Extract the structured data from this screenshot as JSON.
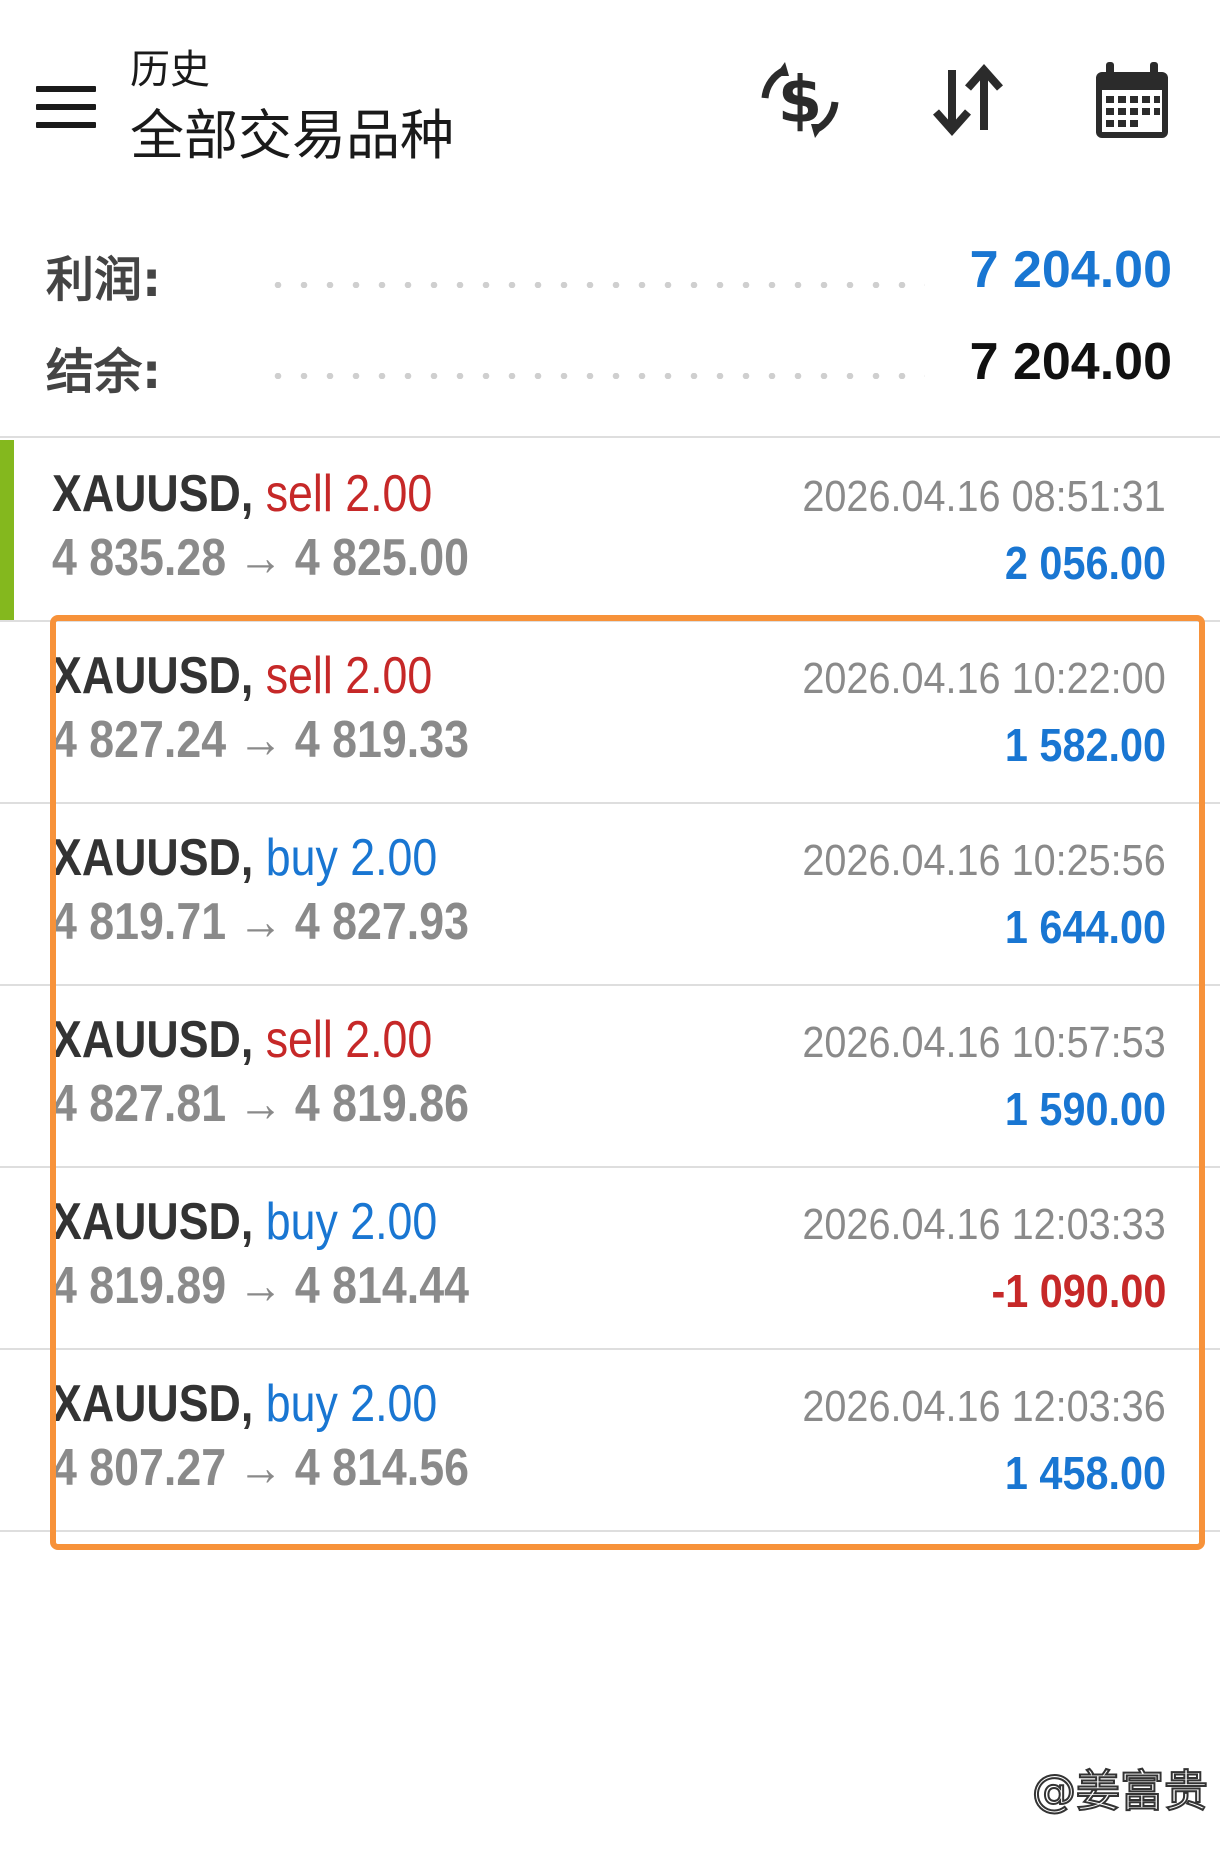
{
  "header": {
    "title_small": "历史",
    "title_big": "全部交易品种",
    "icons": [
      "menu-icon",
      "currency-exchange-icon",
      "sort-icon",
      "calendar-icon"
    ]
  },
  "summary": {
    "profit_label": "利润:",
    "profit_value": "7 204.00",
    "balance_label": "结余:",
    "balance_value": "7 204.00"
  },
  "colors": {
    "profit_positive": "#1976d2",
    "profit_negative": "#c62828",
    "sell": "#c62828",
    "buy": "#1976d2",
    "accent_bar": "#84b81e",
    "highlight_box": "#f7923a"
  },
  "trades": [
    {
      "symbol": "XAUUSD,",
      "type": "sell",
      "volume": "2.00",
      "open_price": "4 835.28",
      "arrow": "→",
      "close_price": "4 825.00",
      "time": "2026.04.16 08:51:31",
      "profit": "2 056.00",
      "profit_sign": "positive"
    },
    {
      "symbol": "XAUUSD,",
      "type": "sell",
      "volume": "2.00",
      "open_price": "4 827.24",
      "arrow": "→",
      "close_price": "4 819.33",
      "time": "2026.04.16 10:22:00",
      "profit": "1 582.00",
      "profit_sign": "positive"
    },
    {
      "symbol": "XAUUSD,",
      "type": "buy",
      "volume": "2.00",
      "open_price": "4 819.71",
      "arrow": "→",
      "close_price": "4 827.93",
      "time": "2026.04.16 10:25:56",
      "profit": "1 644.00",
      "profit_sign": "positive"
    },
    {
      "symbol": "XAUUSD,",
      "type": "sell",
      "volume": "2.00",
      "open_price": "4 827.81",
      "arrow": "→",
      "close_price": "4 819.86",
      "time": "2026.04.16 10:57:53",
      "profit": "1 590.00",
      "profit_sign": "positive"
    },
    {
      "symbol": "XAUUSD,",
      "type": "buy",
      "volume": "2.00",
      "open_price": "4 819.89",
      "arrow": "→",
      "close_price": "4 814.44",
      "time": "2026.04.16 12:03:33",
      "profit": "-1 090.00",
      "profit_sign": "negative"
    },
    {
      "symbol": "XAUUSD,",
      "type": "buy",
      "volume": "2.00",
      "open_price": "4 807.27",
      "arrow": "→",
      "close_price": "4 814.56",
      "time": "2026.04.16 12:03:36",
      "profit": "1 458.00",
      "profit_sign": "positive"
    }
  ],
  "watermark": "@姜富贵"
}
